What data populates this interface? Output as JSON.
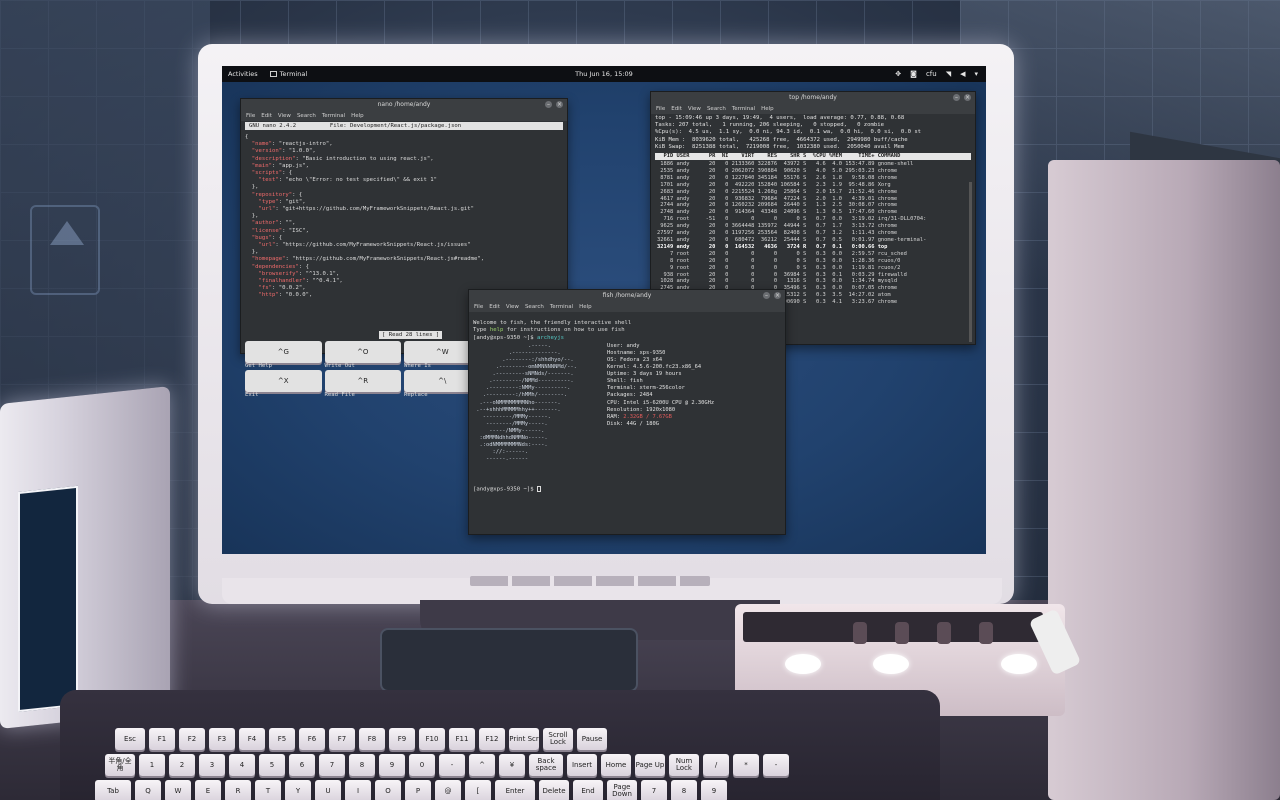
{
  "topbar": {
    "activities": "Activities",
    "app_name": "Terminal",
    "clock": "Thu Jun 16, 15:09",
    "lang": "cfu"
  },
  "nano": {
    "title": "nano /home/andy",
    "menu": [
      "File",
      "Edit",
      "View",
      "Search",
      "Terminal",
      "Help"
    ],
    "header": "GNU nano 2.4.2          File: Development/React.js/package.json",
    "lines": [
      "{",
      "  \"name\": \"reactjs-intro\",",
      "  \"version\": \"1.0.0\",",
      "  \"description\": \"Basic introduction to using react.js\",",
      "  \"main\": \"app.js\",",
      "  \"scripts\": {",
      "    \"test\": \"echo \\\"Error: no test specified\\\" && exit 1\"",
      "  },",
      "  \"repository\": {",
      "    \"type\": \"git\",",
      "    \"url\": \"git+https://github.com/MyFrameworkSnippets/React.js.git\"",
      "  },",
      "  \"author\": \"\",",
      "  \"license\": \"ISC\",",
      "  \"bugs\": {",
      "    \"url\": \"https://github.com/MyFrameworkSnippets/React.js/issues\"",
      "  },",
      "  \"homepage\": \"https://github.com/MyFrameworkSnippets/React.js#readme\",",
      "  \"dependencies\": {",
      "    \"browserify\": \"^13.0.1\",",
      "    \"finalhandler\": \"^0.4.1\",",
      "    \"fs\": \"0.0.2\",",
      "    \"http\": \"0.0.0\","
    ],
    "status": "[ Read 28 lines ]",
    "help": [
      {
        "key": "^G",
        "label": "Get Help"
      },
      {
        "key": "^O",
        "label": "Write Out"
      },
      {
        "key": "^W",
        "label": "Where Is"
      },
      {
        "key": "^K",
        "label": "Cut Text"
      },
      {
        "key": "^X",
        "label": "Exit"
      },
      {
        "key": "^R",
        "label": "Read File"
      },
      {
        "key": "^\\",
        "label": "Replace"
      },
      {
        "key": "^U",
        "label": "Uncut Text"
      }
    ]
  },
  "top": {
    "title": "top /home/andy",
    "menu": [
      "File",
      "Edit",
      "View",
      "Search",
      "Terminal",
      "Help"
    ],
    "summary": [
      "top - 15:09:46 up 3 days, 19:49,  4 users,  load average: 0.77, 0.88, 0.68",
      "Tasks: 207 total,   1 running, 206 sleeping,   0 stopped,   0 zombie",
      "%Cpu(s):  4.5 us,  1.1 sy,  0.0 ni, 94.3 id,  0.1 wa,  0.0 hi,  0.0 si,  0.0 st",
      "KiB Mem :  8039620 total,   425268 free,  4664372 used,  2949980 buff/cache",
      "KiB Swap:  8251388 total,  7219008 free,  1032380 used.  2050040 avail Mem"
    ],
    "header": "  PID USER      PR  NI    VIRT    RES    SHR S  %CPU %MEM     TIME+ COMMAND",
    "rows": [
      " 1886 andy      20   0 2133360 322876  43972 S   4.6  4.0 153:47.89 gnome-shell",
      " 2535 andy      20   0 2062072 390884  90620 S   4.0  5.0 295:03.23 chrome",
      " 8781 andy      20   0 1227840 345184  55176 S   2.6  1.8   9:58.08 chrome",
      " 1701 andy      20   0  492220 152840 106584 S   2.3  1.9  95:48.86 Xorg",
      " 2683 andy      20   0 2215524 1.268g  25864 S   2.0 15.7  21:52.46 chrome",
      " 4617 andy      20   0  936832  79684  47224 S   2.0  1.0   4:39.01 chrome",
      " 2744 andy      20   0 1260232 209684  26440 S   1.3  2.5  30:08.07 chrome",
      " 2748 andy      20   0  914364  43348  24096 S   1.3  0.5  17:47.60 chrome",
      "  716 root     -51   0       0      0      0 S   0.7  0.0   3:19.02 irq/31-DLL0704:",
      " 9625 andy      20   0 3664448 135972  44944 S   0.7  1.7   3:13.72 chrome",
      "27597 andy      20   0 1197256 253564  82408 S   0.7  3.2   1:11.43 chrome",
      "32661 andy      20   0  680472  36212  25444 S   0.7  0.5   0:01.97 gnome-terminal-",
      "32149 andy      20   0  164532   4636   3724 R   0.7  0.1   0:00.66 top",
      "    7 root      20   0       0      0      0 S   0.3  0.0   2:59.57 rcu_sched",
      "    8 root      20   0       0      0      0 S   0.3  0.0   1:28.36 rcuos/0",
      "    9 root      20   0       0      0      0 S   0.3  0.0   1:19.81 rcuos/2",
      "  938 root      20   0       0      0  36984 S   0.3  0.1   0:03.29 firewalld",
      " 1028 andy      20   0       0      0   1316 S   0.3  0.0   1:34.74 mysqld",
      " 2745 andy      20   0       0      0  35496 S   0.3  0.0   0:07.05 chrome",
      " 2746 andy      20   0       0      0  15312 S   0.3  3.5  14:27.02 atom",
      " 2747 andy      20   0       0      0  90690 S   0.3  4.1   3:23.67 chrome"
    ]
  },
  "fish": {
    "title": "fish /home/andy",
    "menu": [
      "File",
      "Edit",
      "View",
      "Search",
      "Terminal",
      "Help"
    ],
    "welcome": "Welcome to fish, the friendly interactive shell",
    "type_prefix": "Type ",
    "type_help": "help",
    "type_suffix": " for instructions on how to use fish",
    "prompt_cmd": "[andy@xps-9350 ~]$ ",
    "cmd": "archeyjs",
    "logo": [
      "                 .-----.",
      "           .--------------.",
      "         .--------:/shhdhyo/--.",
      "       .---------omNMNNNNNMd/--.",
      "      .---------sNMNds/-------.",
      "     .---------/NMMd----------.",
      "    .---------:NMMy----------.",
      "   .---------:/hMMh/--------.",
      "  .---oNMMMMMMMMNho-------.",
      " .--+shhhMMMMMhhy++-------.",
      "   ---------/MMMy------.",
      "    --------/MMMy-----.",
      "     -----/NMMy------.",
      "  :dMMMNdhhdNMMNo-----.",
      "  .:odNMMMMMMMNds:----.",
      "      ://:------.",
      "    ------.------"
    ],
    "info": [
      {
        "label": "User: ",
        "value": "andy"
      },
      {
        "label": "Hostname: ",
        "value": "xps-9350"
      },
      {
        "label": "OS: ",
        "value": "Fedora 23 x64"
      },
      {
        "label": "Kernel: ",
        "value": "4.5.6-200.fc23.x86_64"
      },
      {
        "label": "Uptime: ",
        "value": "3 days 19 hours"
      },
      {
        "label": "Shell: ",
        "value": "fish"
      },
      {
        "label": "Terminal: ",
        "value": "xterm-256color"
      },
      {
        "label": "Packages: ",
        "value": "2484"
      },
      {
        "label": "CPU: ",
        "value": "Intel i5-6200U CPU @ 2.30GHz"
      },
      {
        "label": "Resolution: ",
        "value": "1920x1080"
      },
      {
        "label": "RAM: ",
        "value": "2.32GB / 7.67GB"
      },
      {
        "label": "Disk: ",
        "value": "44G / 180G"
      }
    ],
    "prompt_line": "[andy@xps-9350 ~]$ "
  },
  "keyboard": {
    "row1": [
      "Esc",
      "F1",
      "F2",
      "F3",
      "F4",
      "F5",
      "F6",
      "F7",
      "F8",
      "F9",
      "F10",
      "F11",
      "F12",
      "Print Scr",
      "Scroll Lock",
      "Pause"
    ],
    "row2": [
      "半角/全角",
      "1",
      "2",
      "3",
      "4",
      "5",
      "6",
      "7",
      "8",
      "9",
      "0",
      "-",
      "^",
      "¥",
      "Back space",
      "Insert",
      "Home",
      "Page Up",
      "Num Lock",
      "/",
      "*",
      "-"
    ],
    "row3": [
      "Tab",
      "Q",
      "W",
      "E",
      "R",
      "T",
      "Y",
      "U",
      "I",
      "O",
      "P",
      "@",
      "[",
      "Enter",
      "Delete",
      "End",
      "Page Down",
      "7",
      "8",
      "9"
    ]
  },
  "colors": {
    "desktop": "#21426e",
    "terminal_bg": "#2f3235",
    "accent_red": "#f06b6b",
    "fish_cyan": "#55c7c4"
  }
}
